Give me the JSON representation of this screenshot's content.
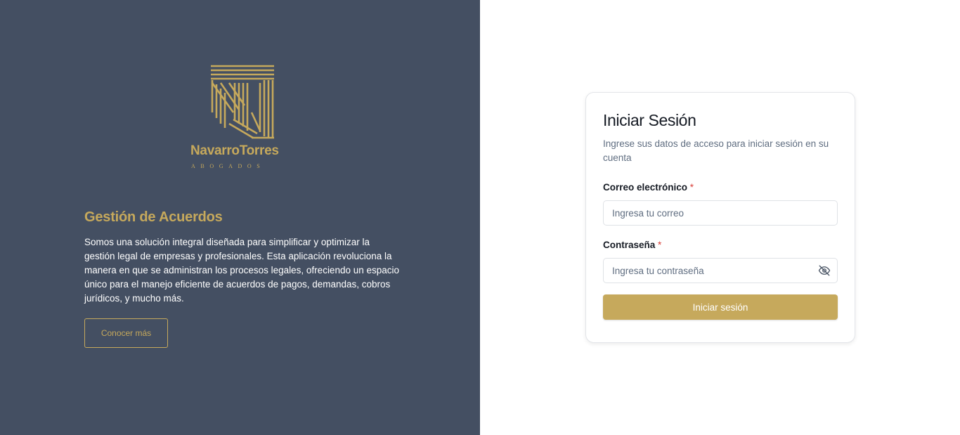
{
  "brand": {
    "name": "NavarroTorres",
    "tagline": "ABOGADOS",
    "color": "#c6a95c",
    "logo_icon": "nt-monogram-logo"
  },
  "intro": {
    "title": "Gestión de Acuerdos",
    "description": "Somos una solución integral diseñada para simplificar y optimizar la gestión legal de empresas y profesionales. Esta aplicación revoluciona la manera en que se administran los procesos legales, ofreciendo un espacio único para el manejo eficiente de acuerdos de pagos, demandas, cobros jurídicos, y mucho más.",
    "learn_more_label": "Conocer más"
  },
  "login": {
    "title": "Iniciar Sesión",
    "subtitle": "Ingrese sus datos de acceso para iniciar sesión en su cuenta",
    "email": {
      "label": "Correo electrónico",
      "required_mark": "*",
      "placeholder": "Ingresa tu correo",
      "value": ""
    },
    "password": {
      "label": "Contraseña",
      "required_mark": "*",
      "placeholder": "Ingresa tu contraseña",
      "value": "",
      "toggle_icon": "eye-off-icon"
    },
    "submit_label": "Iniciar sesión"
  },
  "colors": {
    "left_panel_bg": "#444f62",
    "accent": "#c6a95c",
    "required": "#d9403a"
  }
}
